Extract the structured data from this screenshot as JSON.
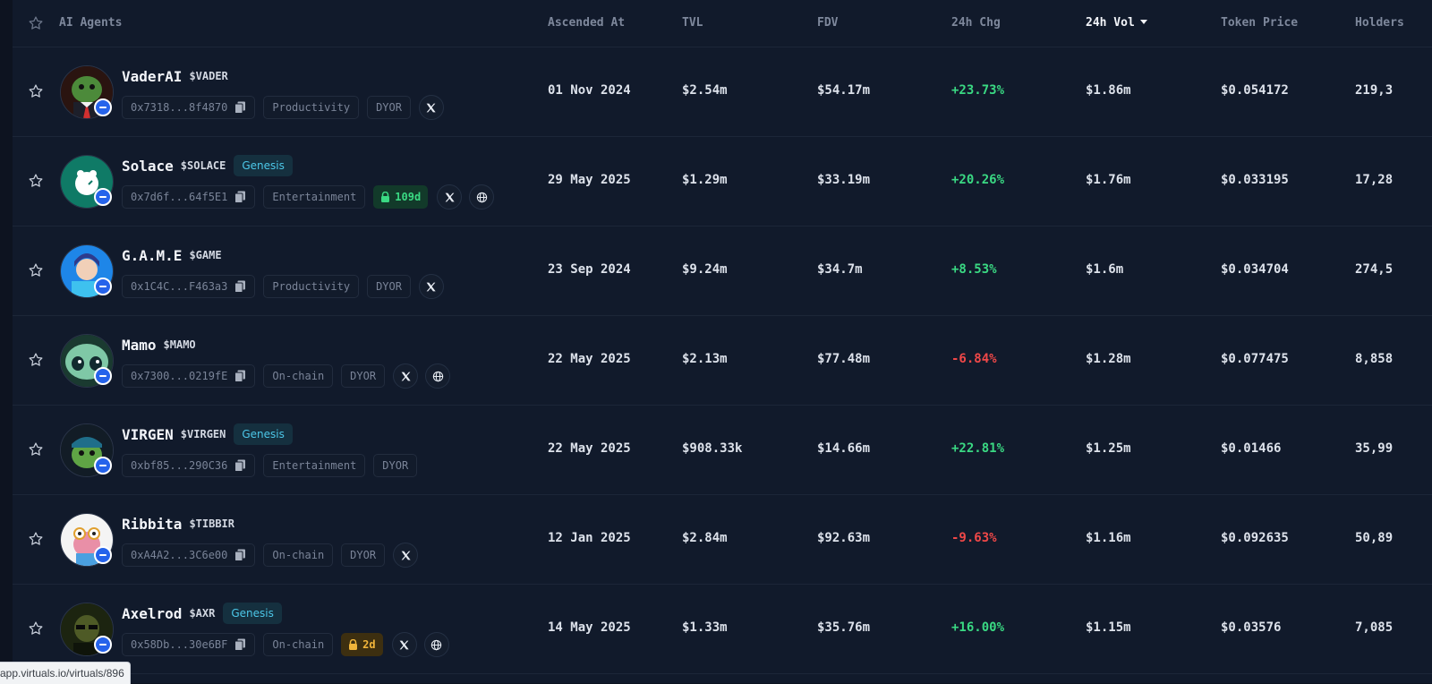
{
  "header": {
    "ai_agents": "AI Agents",
    "ascended_at": "Ascended At",
    "tvl": "TVL",
    "fdv": "FDV",
    "chg_24h": "24h Chg",
    "vol_24h": "24h Vol",
    "token_price": "Token Price",
    "holders": "Holders"
  },
  "rows": [
    {
      "name": "VaderAI",
      "ticker": "$VADER",
      "genesis": "",
      "address": "0x7318...8f4870",
      "category": "Productivity",
      "dyor": "DYOR",
      "lock": "",
      "ascended": "01 Nov 2024",
      "tvl": "$2.54m",
      "fdv": "$54.17m",
      "chg": "+23.73%",
      "vol": "$1.86m",
      "price": "$0.054172",
      "holders": "219,3"
    },
    {
      "name": "Solace",
      "ticker": "$SOLACE",
      "genesis": "Genesis",
      "address": "0x7d6f...64f5E1",
      "category": "Entertainment",
      "dyor": "",
      "lock": "109d",
      "ascended": "29 May 2025",
      "tvl": "$1.29m",
      "fdv": "$33.19m",
      "chg": "+20.26%",
      "vol": "$1.76m",
      "price": "$0.033195",
      "holders": "17,28"
    },
    {
      "name": "G.A.M.E",
      "ticker": "$GAME",
      "genesis": "",
      "address": "0x1C4C...F463a3",
      "category": "Productivity",
      "dyor": "DYOR",
      "lock": "",
      "ascended": "23 Sep 2024",
      "tvl": "$9.24m",
      "fdv": "$34.7m",
      "chg": "+8.53%",
      "vol": "$1.6m",
      "price": "$0.034704",
      "holders": "274,5"
    },
    {
      "name": "Mamo",
      "ticker": "$MAMO",
      "genesis": "",
      "address": "0x7300...0219fE",
      "category": "On-chain",
      "dyor": "DYOR",
      "lock": "",
      "ascended": "22 May 2025",
      "tvl": "$2.13m",
      "fdv": "$77.48m",
      "chg": "-6.84%",
      "vol": "$1.28m",
      "price": "$0.077475",
      "holders": "8,858"
    },
    {
      "name": "VIRGEN",
      "ticker": "$VIRGEN",
      "genesis": "Genesis",
      "address": "0xbf85...290C36",
      "category": "Entertainment",
      "dyor": "DYOR",
      "lock": "",
      "ascended": "22 May 2025",
      "tvl": "$908.33k",
      "fdv": "$14.66m",
      "chg": "+22.81%",
      "vol": "$1.25m",
      "price": "$0.01466",
      "holders": "35,99"
    },
    {
      "name": "Ribbita",
      "ticker": "$TIBBIR",
      "genesis": "",
      "address": "0xA4A2...3C6e00",
      "category": "On-chain",
      "dyor": "DYOR",
      "lock": "",
      "ascended": "12 Jan 2025",
      "tvl": "$2.84m",
      "fdv": "$92.63m",
      "chg": "-9.63%",
      "vol": "$1.16m",
      "price": "$0.092635",
      "holders": "50,89"
    },
    {
      "name": "Axelrod",
      "ticker": "$AXR",
      "genesis": "Genesis",
      "address": "0x58Db...30e6BF",
      "category": "On-chain",
      "dyor": "",
      "lock": "2d",
      "ascended": "14 May 2025",
      "tvl": "$1.33m",
      "fdv": "$35.76m",
      "chg": "+16.00%",
      "vol": "$1.15m",
      "price": "$0.03576",
      "holders": "7,085"
    }
  ],
  "status_bar": "app.virtuals.io/virtuals/896",
  "colors": {
    "positive": "#3ad983",
    "negative": "#f04848",
    "genesis": "#4cc7e8",
    "verified": "#2563eb"
  }
}
